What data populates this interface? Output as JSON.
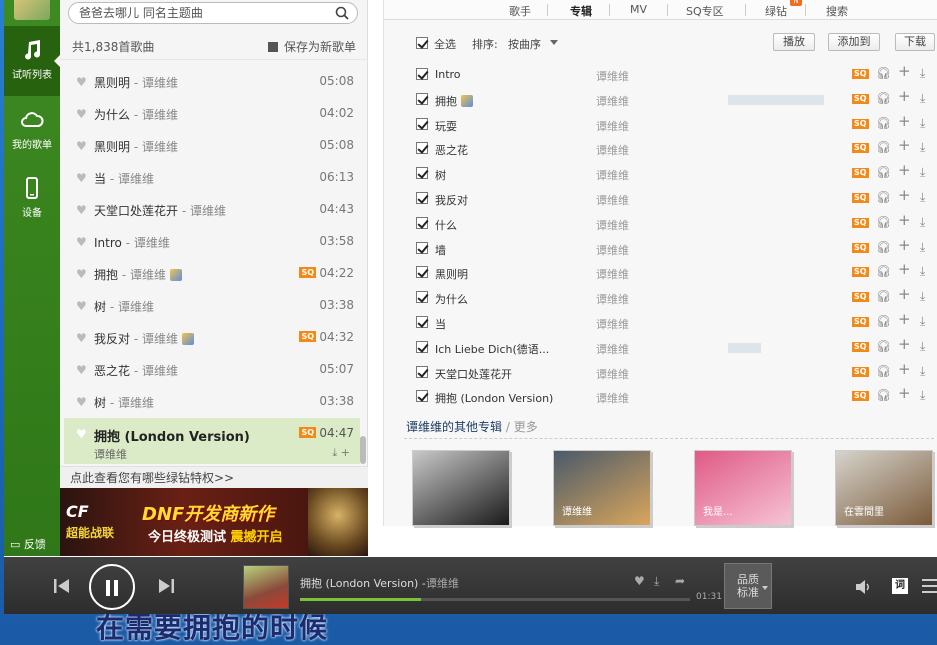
{
  "lyrics": {
    "line": "在需要拥抱的时候"
  },
  "rail": {
    "items": [
      {
        "label": "试听列表",
        "icon": "music-note-icon"
      },
      {
        "label": "我的歌单",
        "icon": "cloud-icon"
      },
      {
        "label": "设备",
        "icon": "phone-icon"
      }
    ],
    "feedback": "反馈"
  },
  "search": {
    "placeholder": "爸爸去哪儿 同名主题曲"
  },
  "playlist": {
    "count_label": "共1,838首歌曲",
    "save_label": "保存为新歌单",
    "songs": [
      {
        "title": "黑则明",
        "artist": "谭维维",
        "duration": "05:08",
        "sq": false
      },
      {
        "title": "为什么",
        "artist": "谭维维",
        "duration": "04:02",
        "sq": false
      },
      {
        "title": "黑则明",
        "artist": "谭维维",
        "duration": "05:08",
        "sq": false
      },
      {
        "title": "当",
        "artist": "谭维维",
        "duration": "06:13",
        "sq": false
      },
      {
        "title": "天堂口处莲花开",
        "artist": "谭维维",
        "duration": "04:43",
        "sq": false
      },
      {
        "title": "Intro",
        "artist": "谭维维",
        "duration": "03:58",
        "sq": false
      },
      {
        "title": "拥抱",
        "artist": "谭维维",
        "duration": "04:22",
        "sq": true
      },
      {
        "title": "树",
        "artist": "谭维维",
        "duration": "03:38",
        "sq": false
      },
      {
        "title": "我反对",
        "artist": "谭维维",
        "duration": "04:32",
        "sq": true
      },
      {
        "title": "恶之花",
        "artist": "谭维维",
        "duration": "05:07",
        "sq": false
      },
      {
        "title": "树",
        "artist": "谭维维",
        "duration": "03:38",
        "sq": false
      }
    ],
    "now_playing": {
      "title": "拥抱 (London Version)",
      "artist": "谭维维",
      "duration": "04:47",
      "sq_label": "SQ"
    },
    "sq_label": "SQ",
    "promo_link": "点此查看您有哪些绿钻特权>>"
  },
  "banner": {
    "logo": "CF",
    "logo_sub": "超能战联",
    "headline": "DNF开发商新作",
    "subline": "今日终极测试",
    "subline_hl": "震撼开启"
  },
  "tabs": {
    "items": [
      "歌手",
      "专辑",
      "MV",
      "SQ专区",
      "绿钻",
      "搜索"
    ],
    "active": "专辑",
    "badge": "N"
  },
  "toolbar": {
    "select_all": "全选",
    "sort_label": "排序:",
    "sort_value": "按曲序",
    "play": "播放",
    "add_to": "添加到",
    "download": "下载"
  },
  "tracks": [
    {
      "name": "Intro",
      "artist": "谭维维",
      "popularity": 0.0,
      "badge": false
    },
    {
      "name": "拥抱",
      "artist": "谭维维",
      "popularity": 0.75,
      "badge": true
    },
    {
      "name": "玩耍",
      "artist": "谭维维",
      "popularity": 0.0,
      "badge": false
    },
    {
      "name": "恶之花",
      "artist": "谭维维",
      "popularity": 0.0,
      "badge": false
    },
    {
      "name": "树",
      "artist": "谭维维",
      "popularity": 0.0,
      "badge": false
    },
    {
      "name": "我反对",
      "artist": "谭维维",
      "popularity": 0.0,
      "badge": false
    },
    {
      "name": "什么",
      "artist": "谭维维",
      "popularity": 0.0,
      "badge": false
    },
    {
      "name": "墙",
      "artist": "谭维维",
      "popularity": 0.0,
      "badge": false
    },
    {
      "name": "黑则明",
      "artist": "谭维维",
      "popularity": 0.0,
      "badge": false
    },
    {
      "name": "为什么",
      "artist": "谭维维",
      "popularity": 0.0,
      "badge": false
    },
    {
      "name": "当",
      "artist": "谭维维",
      "popularity": 0.0,
      "badge": false
    },
    {
      "name": "Ich Liebe Dich(德语...",
      "artist": "谭维维",
      "popularity": 0.26,
      "badge": false
    },
    {
      "name": "天堂口处莲花开",
      "artist": "谭维维",
      "popularity": 0.0,
      "badge": false
    },
    {
      "name": "拥抱 (London Version)",
      "artist": "谭维维",
      "popularity": 0.0,
      "badge": false
    }
  ],
  "track_sq_label": "SQ",
  "more_albums": {
    "title": "谭维维的其他专辑",
    "more": "更多",
    "albums": [
      {
        "name": "album-cover-1",
        "color_a": "#c9c9c9",
        "color_b": "#1a1a1a",
        "caption": ""
      },
      {
        "name": "album-cover-2",
        "color_a": "#4a5a6a",
        "color_b": "#d9a65c",
        "caption": "谭维维"
      },
      {
        "name": "album-cover-3",
        "color_a": "#e05a86",
        "color_b": "#f6c3d4",
        "caption": "我是..."
      },
      {
        "name": "album-cover-4",
        "color_a": "#d6d4cc",
        "color_b": "#7a5a3a",
        "caption": "在雲間里"
      }
    ]
  },
  "player": {
    "title": "拥抱 (London Version)",
    "separator": "-",
    "artist": "谭维维",
    "elapsed": "01:31",
    "progress": 0.31,
    "quality_line1": "品质",
    "quality_line2": "标准",
    "lyric_button": "词"
  },
  "colors": {
    "rail_green": "#3e8a22",
    "sq_orange": "#f28a18",
    "progress_green": "#79c33a"
  }
}
